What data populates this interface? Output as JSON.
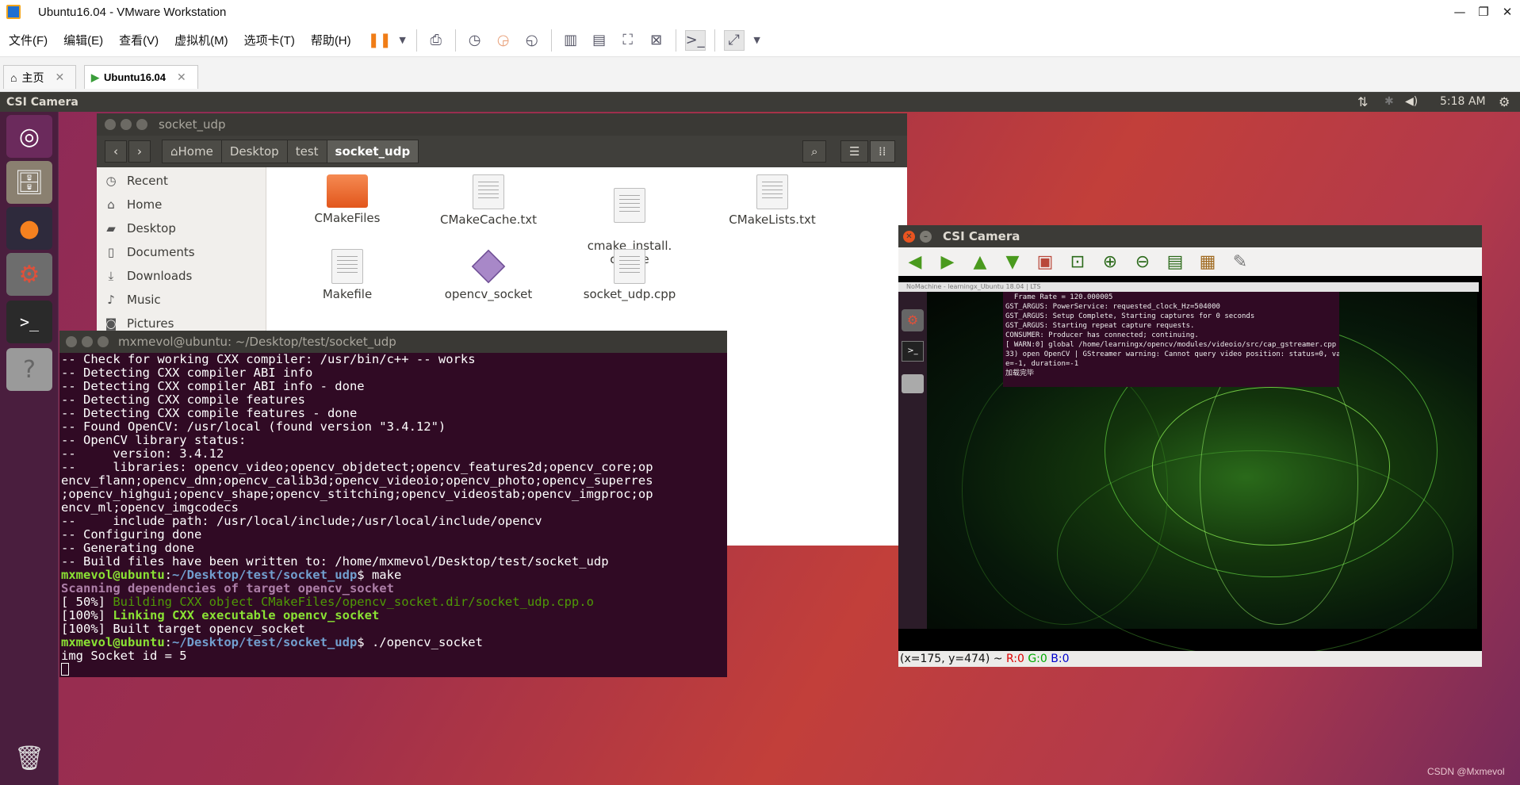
{
  "vmware": {
    "title": "Ubuntu16.04 - VMware Workstation",
    "menu": [
      "文件(F)",
      "编辑(E)",
      "查看(V)",
      "虚拟机(M)",
      "选项卡(T)",
      "帮助(H)"
    ],
    "tabs": [
      {
        "label": "主页"
      },
      {
        "label": "Ubuntu16.04"
      }
    ]
  },
  "panel": {
    "app_title": "CSI Camera",
    "time": "5:18 AM"
  },
  "nautilus": {
    "title": "socket_udp",
    "breadcrumbs": [
      "Home",
      "Desktop",
      "test",
      "socket_udp"
    ],
    "sidebar": [
      "Recent",
      "Home",
      "Desktop",
      "Documents",
      "Downloads",
      "Music",
      "Pictures"
    ],
    "files": [
      {
        "name": "CMakeFiles",
        "type": "folder"
      },
      {
        "name": "CMakeCache.txt",
        "type": "text"
      },
      {
        "name": "cmake_install.\ncmake",
        "type": "text"
      },
      {
        "name": "CMakeLists.txt",
        "type": "text"
      },
      {
        "name": "Makefile",
        "type": "text"
      },
      {
        "name": "opencv_socket",
        "type": "exec"
      },
      {
        "name": "socket_udp.cpp",
        "type": "cpp"
      }
    ]
  },
  "terminal": {
    "title": "mxmevol@ubuntu: ~/Desktop/test/socket_udp",
    "prompt_user": "mxmevol@ubuntu",
    "prompt_path": "~/Desktop/test/socket_udp",
    "lines": [
      "-- Check for working CXX compiler: /usr/bin/c++ -- works",
      "-- Detecting CXX compiler ABI info",
      "-- Detecting CXX compiler ABI info - done",
      "-- Detecting CXX compile features",
      "-- Detecting CXX compile features - done",
      "-- Found OpenCV: /usr/local (found version \"3.4.12\")",
      "-- OpenCV library status:",
      "--     version: 3.4.12",
      "--     libraries: opencv_video;opencv_objdetect;opencv_features2d;opencv_core;op",
      "encv_flann;opencv_dnn;opencv_calib3d;opencv_videoio;opencv_photo;opencv_superres",
      ";opencv_highgui;opencv_shape;opencv_stitching;opencv_videostab;opencv_imgproc;op",
      "encv_ml;opencv_imgcodecs",
      "--     include path: /usr/local/include;/usr/local/include/opencv",
      "-- Configuring done",
      "-- Generating done",
      "-- Build files have been written to: /home/mxmevol/Desktop/test/socket_udp"
    ],
    "cmd1": "$ make",
    "scan": "Scanning dependencies of target opencv_socket",
    "b50_pre": "[ 50%] ",
    "b50": "Building CXX object CMakeFiles/opencv_socket.dir/socket_udp.cpp.o",
    "b100_pre": "[100%] ",
    "b100": "Linking CXX executable opencv_socket",
    "built": "[100%] Built target opencv_socket",
    "cmd2": "$ ./opencv_socket",
    "last": "img Socket id = 5"
  },
  "csi": {
    "title": "CSI Camera",
    "nomachine": "NoMachine - learningx_Ubuntu 18.04 | LTS",
    "inner_lines": [
      "  Frame Rate = 120.000005",
      "GST_ARGUS: PowerService: requested_clock_Hz=504000",
      "GST_ARGUS: Setup Complete, Starting captures for 0 seconds",
      "GST_ARGUS: Starting repeat capture requests.",
      "CONSUMER: Producer has connected; continuing.",
      "[ WARN:0] global /home/learningx/opencv/modules/videoio/src/cap_gstreamer.cpp (9",
      "33) open OpenCV | GStreamer warning: Cannot query video position: status=0, valu",
      "e=-1, duration=-1",
      "加载完毕"
    ],
    "status_coords": "(x=175, y=474) ~",
    "r": "R:0",
    "g": "G:0",
    "b": "B:0"
  },
  "watermark": "CSDN @Mxmevol"
}
